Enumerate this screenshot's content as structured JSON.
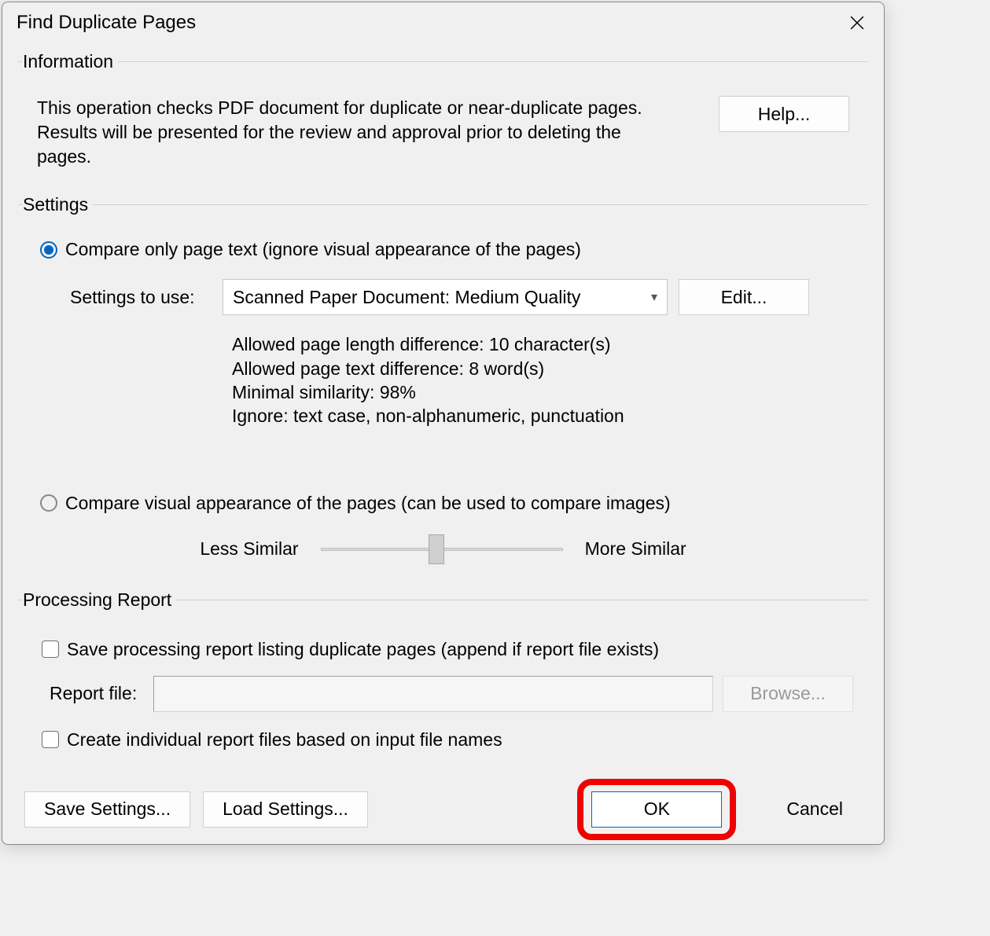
{
  "dialog": {
    "title": "Find Duplicate Pages",
    "groups": {
      "information": {
        "legend": "Information",
        "text": "This operation checks PDF document for duplicate or near-duplicate pages. Results will be presented for the review and approval prior to deleting the pages.",
        "help_button": "Help..."
      },
      "settings": {
        "legend": "Settings",
        "radio_text": "Compare only page text (ignore visual appearance of the pages)",
        "settings_to_use_label": "Settings to use:",
        "selected_preset": "Scanned Paper Document: Medium Quality",
        "edit_button": "Edit...",
        "details": {
          "line1": "Allowed page length difference: 10 character(s)",
          "line2": "Allowed page text difference: 8 word(s)",
          "line3": "Minimal similarity: 98%",
          "line4": "Ignore: text case, non-alphanumeric, punctuation"
        },
        "radio_visual": "Compare visual appearance of the pages (can be used to compare images)",
        "slider_less": "Less Similar",
        "slider_more": "More Similar"
      },
      "report": {
        "legend": "Processing Report",
        "save_report_label": "Save processing report listing duplicate pages (append if report file exists)",
        "report_file_label": "Report file:",
        "report_file_value": "",
        "browse_button": "Browse...",
        "individual_label": "Create individual report files based on input file names"
      }
    },
    "buttons": {
      "save_settings": "Save Settings...",
      "load_settings": "Load Settings...",
      "ok": "OK",
      "cancel": "Cancel"
    }
  }
}
